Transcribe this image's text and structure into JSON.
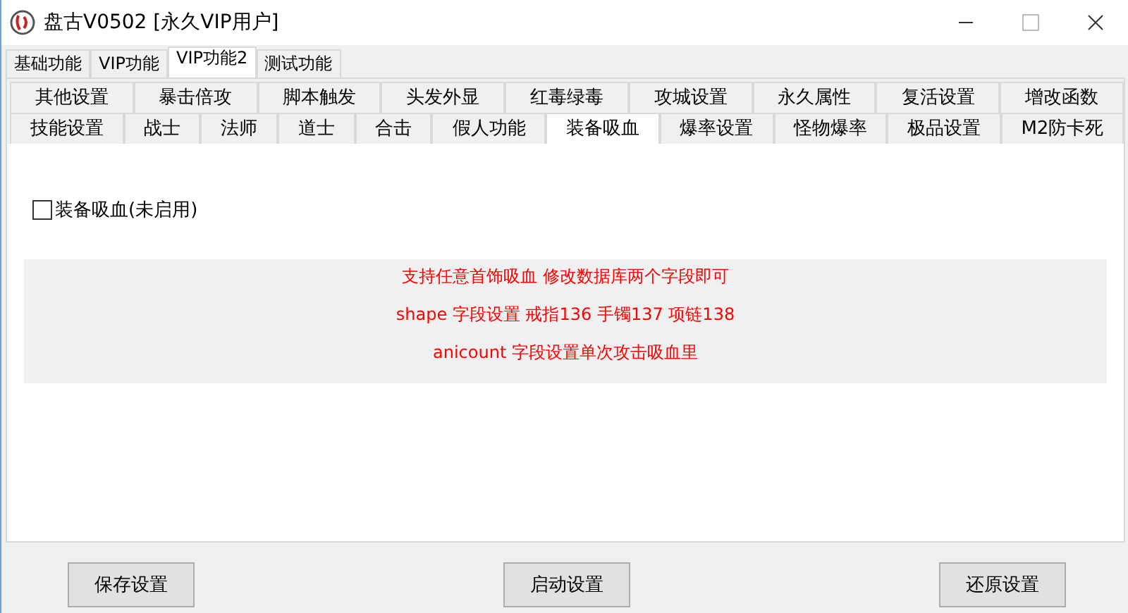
{
  "window": {
    "title": "盘古V0502 [永久VIP用户]"
  },
  "tabs": [
    {
      "label": "基础功能",
      "selected": false
    },
    {
      "label": "VIP功能",
      "selected": false
    },
    {
      "label": "VIP功能2",
      "selected": true
    },
    {
      "label": "测试功能",
      "selected": false
    }
  ],
  "sub_tab_rows": [
    [
      {
        "label": "其他设置",
        "selected": false
      },
      {
        "label": "暴击倍攻",
        "selected": false
      },
      {
        "label": "脚本触发",
        "selected": false
      },
      {
        "label": "头发外显",
        "selected": false
      },
      {
        "label": "红毒绿毒",
        "selected": false
      },
      {
        "label": "攻城设置",
        "selected": false
      },
      {
        "label": "永久属性",
        "selected": false
      },
      {
        "label": "复活设置",
        "selected": false
      },
      {
        "label": "增改函数",
        "selected": false
      }
    ],
    [
      {
        "label": "技能设置",
        "selected": false
      },
      {
        "label": "战士",
        "selected": false
      },
      {
        "label": "法师",
        "selected": false
      },
      {
        "label": "道士",
        "selected": false
      },
      {
        "label": "合击",
        "selected": false
      },
      {
        "label": "假人功能",
        "selected": false
      },
      {
        "label": "装备吸血",
        "selected": true
      },
      {
        "label": "爆率设置",
        "selected": false
      },
      {
        "label": "怪物爆率",
        "selected": false
      },
      {
        "label": "极品设置",
        "selected": false
      },
      {
        "label": "M2防卡死",
        "selected": false
      }
    ]
  ],
  "checkbox": {
    "label": "装备吸血(未启用)",
    "checked": false
  },
  "notes": [
    "支持任意首饰吸血 修改数据库两个字段即可",
    "shape 字段设置 戒指136 手镯137 项链138",
    "anicount 字段设置单次攻击吸血里"
  ],
  "buttons": [
    "保存设置",
    "启动设置",
    "还原设置"
  ]
}
